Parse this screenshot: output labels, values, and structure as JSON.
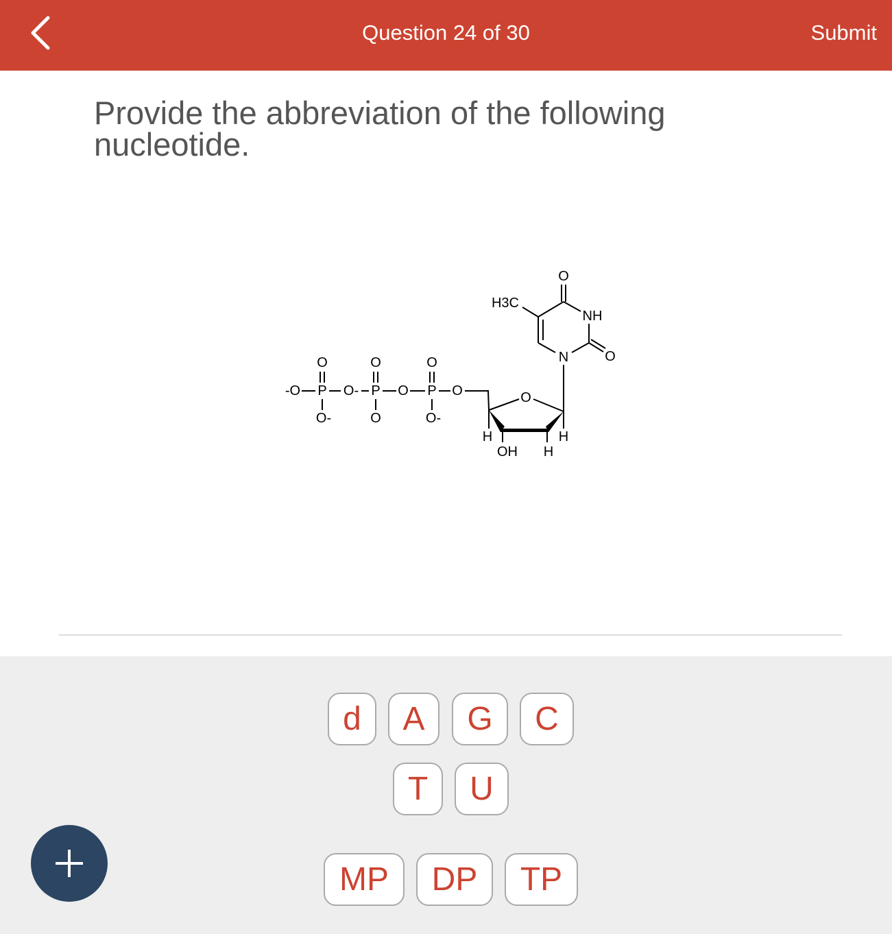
{
  "header": {
    "title": "Question 24 of 30",
    "submit_label": "Submit",
    "back_icon": "chevron-left-icon",
    "background": "#CC4331"
  },
  "question": {
    "text": "Provide the abbreviation of the following nucleotide."
  },
  "molecule": {
    "labels": {
      "o_minus_terminal": "-O",
      "p1": "P",
      "o_bridge1": "O-",
      "p2": "P",
      "o_bridge2": "O",
      "p3": "P",
      "o_ester": "O",
      "o_top1": "O",
      "o_top2": "O",
      "o_top3": "O",
      "o_bottom1": "O-",
      "o_bottom2": "O",
      "o_bottom3": "O-",
      "ring_o": "O",
      "h4": "H",
      "oh3": "OH",
      "h2": "H",
      "h1": "H",
      "n1": "N",
      "n3": "NH",
      "o2": "O",
      "o4": "O",
      "methyl": "H3C"
    }
  },
  "keypad": {
    "row1": [
      "d",
      "A",
      "G",
      "C"
    ],
    "row2": [
      "T",
      "U"
    ],
    "row3": [
      "MP",
      "DP",
      "TP"
    ],
    "key_text_color": "#CC4331"
  },
  "fab": {
    "icon": "plus-icon",
    "color": "#2B4563"
  }
}
